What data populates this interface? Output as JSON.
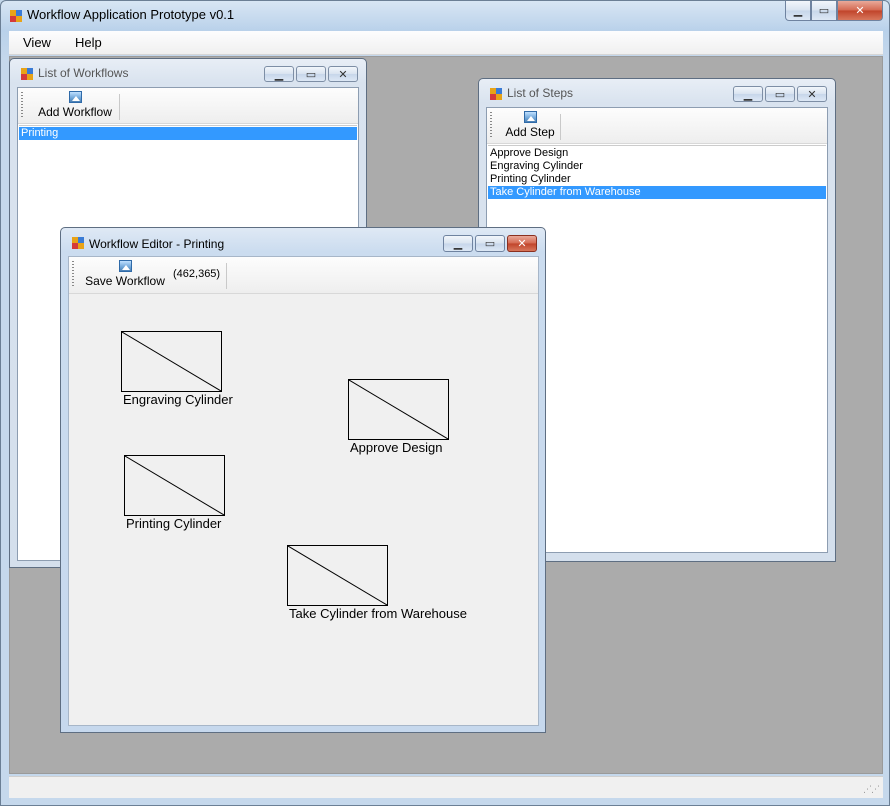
{
  "app": {
    "title": "Workflow Application Prototype v0.1"
  },
  "menu": {
    "items": [
      "View",
      "Help"
    ]
  },
  "workflows_window": {
    "title": "List of Workflows",
    "toolbar": {
      "add_label": "Add Workflow"
    },
    "items": [
      {
        "label": "Printing",
        "selected": true
      }
    ]
  },
  "steps_window": {
    "title": "List of Steps",
    "toolbar": {
      "add_label": "Add Step"
    },
    "items": [
      {
        "label": "Approve Design",
        "selected": false
      },
      {
        "label": "Engraving Cylinder",
        "selected": false
      },
      {
        "label": "Printing Cylinder",
        "selected": false
      },
      {
        "label": "Take Cylinder from Warehouse",
        "selected": true
      }
    ]
  },
  "editor_window": {
    "title": "Workflow Editor - Printing",
    "toolbar": {
      "save_label": "Save Workflow",
      "coordinates": "(462,365)"
    },
    "steps": [
      {
        "label": "Engraving Cylinder"
      },
      {
        "label": "Approve Design"
      },
      {
        "label": "Printing Cylinder"
      },
      {
        "label": "Take Cylinder from Warehouse"
      }
    ]
  },
  "colors": {
    "selection": "#3399ff",
    "mdi_background": "#ababab",
    "close_button": "#c0432a"
  },
  "icons": [
    "app-icon",
    "minimize-icon",
    "maximize-icon",
    "close-icon",
    "image-icon",
    "resize-grip-icon"
  ]
}
